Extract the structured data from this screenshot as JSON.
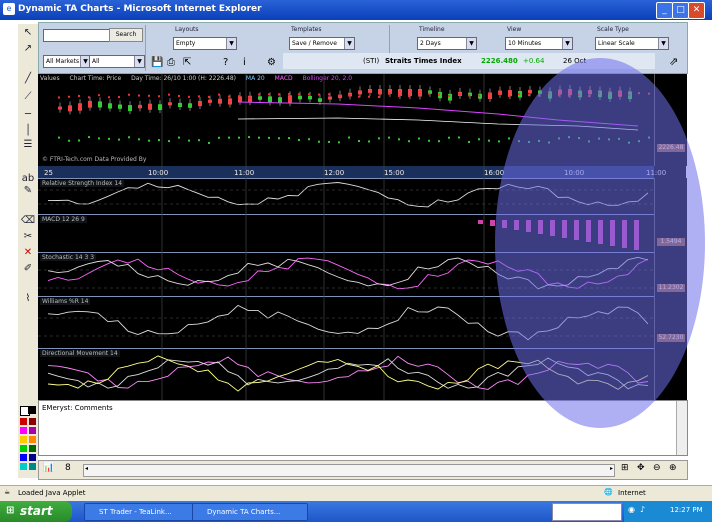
{
  "window": {
    "title": "Dynamic TA Charts - Microsoft Internet Explorer"
  },
  "left_tools": [
    "pointer-icon",
    "crosshair-icon",
    "line-icon",
    "trendline-icon",
    "vline-icon",
    "hline-icon",
    "fib-icon",
    "pencil-icon",
    "eraser-icon",
    "scissors-icon",
    "delete-icon",
    "edit-icon",
    "brush-icon"
  ],
  "controls": {
    "search_value": "",
    "search_button": "Search",
    "market_select": "All Markets",
    "all_select": "All",
    "layouts_label": "Layouts",
    "layouts_value": "Empty",
    "templates_label": "Templates",
    "templates_value": "Save / Remove",
    "timeline_label": "Timeline",
    "timeline_value": "2 Days",
    "view_label": "View",
    "view_value": "10 Minutes",
    "scale_label": "Scale Type",
    "scale_value": "Linear Scale",
    "instrument": "Straits Times Index",
    "instrument_code": "(STI)",
    "price": "2226.480",
    "change": "+0.64",
    "time": "26 Oct"
  },
  "main_legend": {
    "values_label": "Values",
    "items": [
      "Chart Time: Price",
      "Day Time: 26/10 1:00  (H: 2226.48)",
      "MA 20",
      "MACD",
      "Bollinger 20, 2.0"
    ],
    "credit": "© FTRI-Tech.com  Data Provided By"
  },
  "panes": [
    {
      "title": "Relative Strength Index 14",
      "last": ""
    },
    {
      "title": "MACD 12 26 9",
      "last": "1.5494"
    },
    {
      "title": "Stochastic 14 3 3",
      "last": "11.2302"
    },
    {
      "title": "Williams %R 14",
      "last": "52.7230"
    },
    {
      "title": "Directional Movement 14",
      "last": ""
    }
  ],
  "time_labels": [
    "25",
    "10:00",
    "11:00",
    "12:00",
    "15:00",
    "16:00",
    "10:00",
    "11:00"
  ],
  "main_last": "2226.48",
  "comments_label": "EMeryst: Comments",
  "status_text": "Loaded Java Applet",
  "status_zone": "Internet",
  "taskbar": {
    "start": "start",
    "items": [
      "ST Trader - TeaLink...",
      "Dynamic TA Charts..."
    ],
    "clock": "12:27 PM"
  }
}
